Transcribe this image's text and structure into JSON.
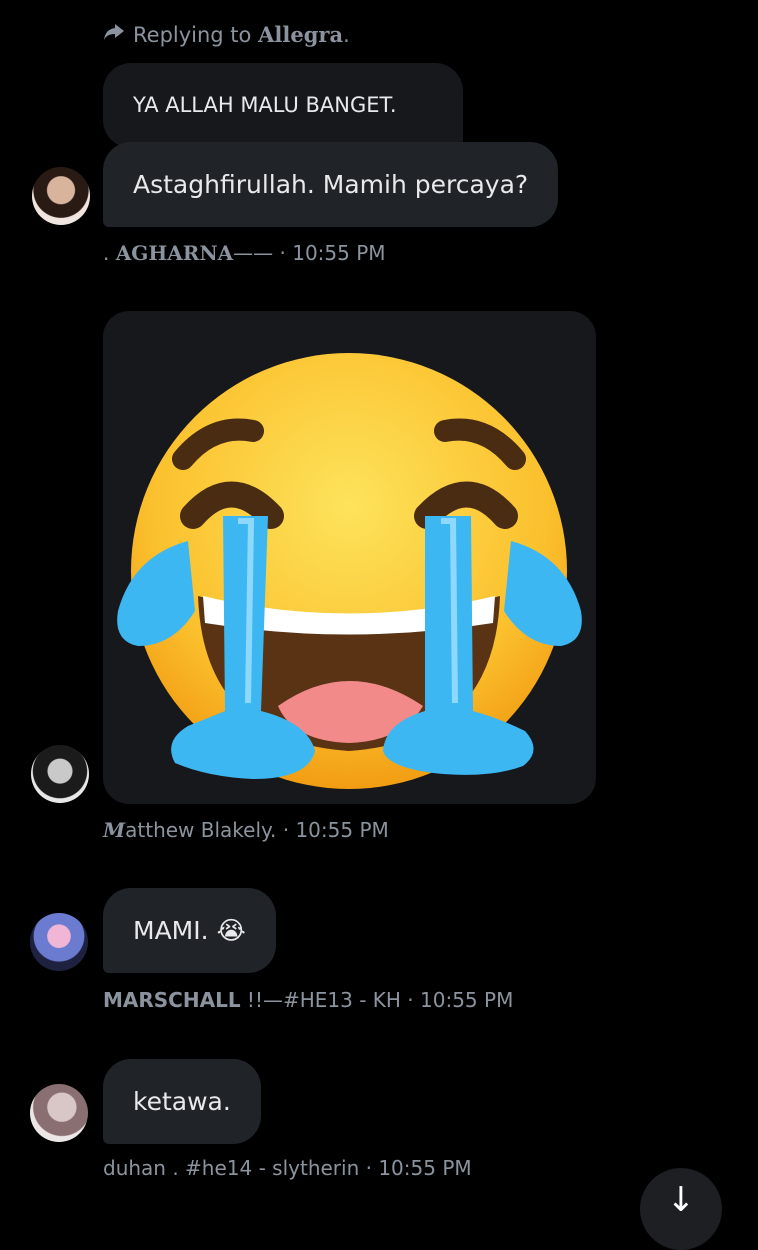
{
  "reply": {
    "prefix": "Replying to",
    "name": "Allegra",
    "suffix": "."
  },
  "messages": [
    {
      "quoted": "YA ALLAH MALU BANGET.",
      "text": "Astaghfirullah. Mamih percaya?",
      "sender_prefix": ". ",
      "sender": "AGHARNA",
      "sender_suffix": "—— · 10:55 PM"
    },
    {
      "media": "loudly-crying-face-emoji",
      "sender_initial": "M",
      "sender_rest": "atthew Blakely. · 10:55 PM"
    },
    {
      "text": "MAMI.",
      "emoji": "😭",
      "sender": "MARSCHALL",
      "sender_rest": " !!—#HE13 - KH · 10:55 PM"
    },
    {
      "text": "ketawa.",
      "sender_rest": "duhan . #he14 - slytherin · 10:55 PM"
    }
  ],
  "colors": {
    "bubble": "#202327",
    "quoted_bubble": "#16181c",
    "meta": "#8b949e",
    "background": "#000000"
  },
  "icons": {
    "reply": "reply-arrow-icon",
    "fab": "scroll-down-icon"
  }
}
